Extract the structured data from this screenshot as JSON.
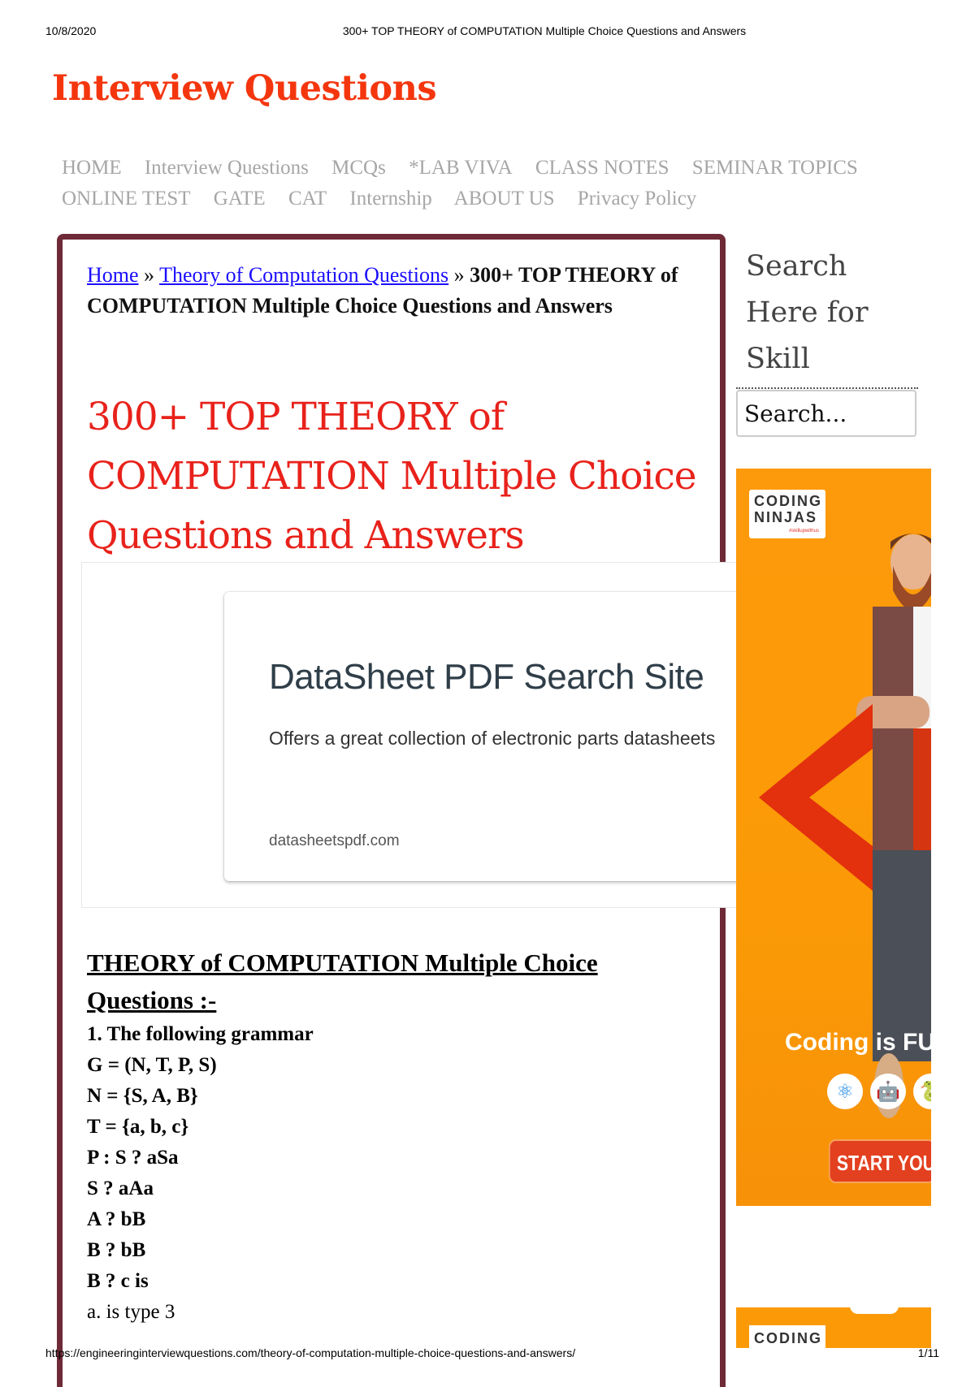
{
  "print_header": {
    "date": "10/8/2020",
    "title": "300+ TOP THEORY of COMPUTATION Multiple Choice Questions and Answers"
  },
  "print_footer": {
    "url": "https://engineeringinterviewquestions.com/theory-of-computation-multiple-choice-questions-and-answers/",
    "page": "1/11"
  },
  "site": {
    "title": "Interview Questions",
    "brand_color": "#f4360e"
  },
  "nav": {
    "items": [
      {
        "label": "HOME"
      },
      {
        "label": "Interview Questions"
      },
      {
        "label": "MCQs"
      },
      {
        "label": "*LAB VIVA"
      },
      {
        "label": "CLASS NOTES"
      },
      {
        "label": "SEMINAR TOPICS"
      },
      {
        "label": "ONLINE TEST"
      },
      {
        "label": "GATE"
      },
      {
        "label": "CAT"
      },
      {
        "label": "Internship"
      },
      {
        "label": "ABOUT US"
      },
      {
        "label": "Privacy Policy"
      }
    ]
  },
  "breadcrumb": {
    "home": "Home",
    "separator": "»",
    "category": "Theory of Computation Questions",
    "current": "300+ TOP THEORY of COMPUTATION Multiple Choice Questions and Answers"
  },
  "article": {
    "heading": "300+ TOP THEORY of COMPUTATION Multiple Choice Questions and Answers",
    "heading_color": "#e8221b",
    "border_color": "#6e2a36",
    "section_title": "THEORY of COMPUTATION Multiple Choice Questions :-",
    "question_lines": [
      "1. The following grammar",
      "G = (N, T, P, S)",
      "N = {S, A, B}",
      "T = {a, b, c}",
      "P : S ? aSa",
      "S ? aAa",
      "A ? bB",
      "B ? bB",
      "B ? c is"
    ],
    "options": [
      "a. is type 3"
    ]
  },
  "ad": {
    "headline": "DataSheet PDF Search Site",
    "subtext": "Offers a great collection of electronic parts datasheets",
    "domain": "datasheetspdf.com"
  },
  "sidebar": {
    "search_label": "Search Here for Skill",
    "search_placeholder": "Search...",
    "banner": {
      "logo_line1": "CODING",
      "logo_line2": "NINJAS",
      "logo_tag": "#skillupwithus",
      "tagline": "Coding is FUN",
      "tech_icons": [
        "react-icon",
        "android-icon",
        "python-icon"
      ],
      "cta": "START YOUR FREE TRIAL",
      "bg_color": "#fb9a06"
    }
  }
}
